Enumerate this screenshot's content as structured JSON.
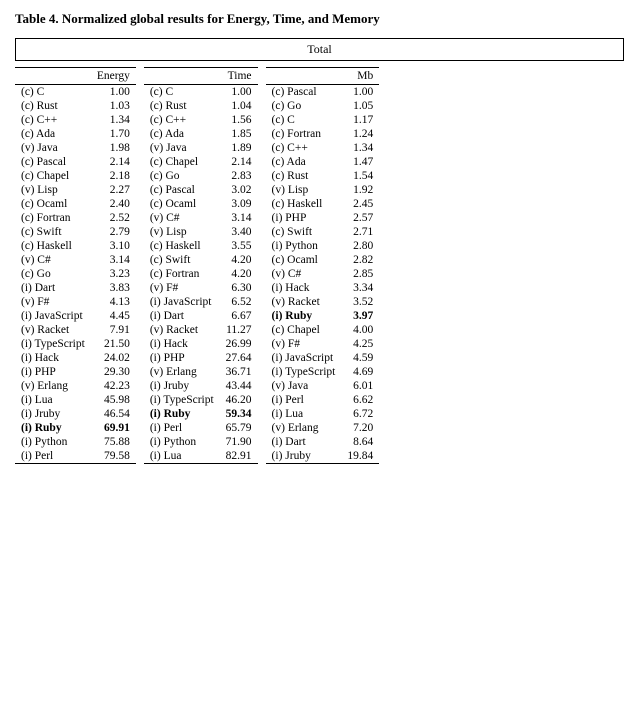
{
  "title": "Table 4. Normalized global results for Energy, Time, and Memory",
  "total_label": "Total",
  "energy_table": {
    "header": [
      "",
      "Energy"
    ],
    "rows": [
      [
        "(c) C",
        "1.00"
      ],
      [
        "(c) Rust",
        "1.03"
      ],
      [
        "(c) C++",
        "1.34"
      ],
      [
        "(c) Ada",
        "1.70"
      ],
      [
        "(v) Java",
        "1.98"
      ],
      [
        "(c) Pascal",
        "2.14"
      ],
      [
        "(c) Chapel",
        "2.18"
      ],
      [
        "(v) Lisp",
        "2.27"
      ],
      [
        "(c) Ocaml",
        "2.40"
      ],
      [
        "(c) Fortran",
        "2.52"
      ],
      [
        "(c) Swift",
        "2.79"
      ],
      [
        "(c) Haskell",
        "3.10"
      ],
      [
        "(v) C#",
        "3.14"
      ],
      [
        "(c) Go",
        "3.23"
      ],
      [
        "(i) Dart",
        "3.83"
      ],
      [
        "(v) F#",
        "4.13"
      ],
      [
        "(i) JavaScript",
        "4.45"
      ],
      [
        "(v) Racket",
        "7.91"
      ],
      [
        "(i) TypeScript",
        "21.50"
      ],
      [
        "(i) Hack",
        "24.02"
      ],
      [
        "(i) PHP",
        "29.30"
      ],
      [
        "(v) Erlang",
        "42.23"
      ],
      [
        "(i) Lua",
        "45.98"
      ],
      [
        "(i) Jruby",
        "46.54"
      ],
      [
        "(i) Ruby",
        "69.91"
      ],
      [
        "(i) Python",
        "75.88"
      ],
      [
        "(i) Perl",
        "79.58"
      ]
    ]
  },
  "time_table": {
    "header": [
      "",
      "Time"
    ],
    "rows": [
      [
        "(c) C",
        "1.00"
      ],
      [
        "(c) Rust",
        "1.04"
      ],
      [
        "(c) C++",
        "1.56"
      ],
      [
        "(c) Ada",
        "1.85"
      ],
      [
        "(v) Java",
        "1.89"
      ],
      [
        "(c) Chapel",
        "2.14"
      ],
      [
        "(c) Go",
        "2.83"
      ],
      [
        "(c) Pascal",
        "3.02"
      ],
      [
        "(c) Ocaml",
        "3.09"
      ],
      [
        "(v) C#",
        "3.14"
      ],
      [
        "(v) Lisp",
        "3.40"
      ],
      [
        "(c) Haskell",
        "3.55"
      ],
      [
        "(c) Swift",
        "4.20"
      ],
      [
        "(c) Fortran",
        "4.20"
      ],
      [
        "(v) F#",
        "6.30"
      ],
      [
        "(i) JavaScript",
        "6.52"
      ],
      [
        "(i) Dart",
        "6.67"
      ],
      [
        "(v) Racket",
        "11.27"
      ],
      [
        "(i) Hack",
        "26.99"
      ],
      [
        "(i) PHP",
        "27.64"
      ],
      [
        "(v) Erlang",
        "36.71"
      ],
      [
        "(i) Jruby",
        "43.44"
      ],
      [
        "(i) TypeScript",
        "46.20"
      ],
      [
        "(i) Ruby",
        "59.34"
      ],
      [
        "(i) Perl",
        "65.79"
      ],
      [
        "(i) Python",
        "71.90"
      ],
      [
        "(i) Lua",
        "82.91"
      ]
    ]
  },
  "memory_table": {
    "header": [
      "",
      "Mb"
    ],
    "rows": [
      [
        "(c) Pascal",
        "1.00"
      ],
      [
        "(c) Go",
        "1.05"
      ],
      [
        "(c) C",
        "1.17"
      ],
      [
        "(c) Fortran",
        "1.24"
      ],
      [
        "(c) C++",
        "1.34"
      ],
      [
        "(c) Ada",
        "1.47"
      ],
      [
        "(c) Rust",
        "1.54"
      ],
      [
        "(v) Lisp",
        "1.92"
      ],
      [
        "(c) Haskell",
        "2.45"
      ],
      [
        "(i) PHP",
        "2.57"
      ],
      [
        "(c) Swift",
        "2.71"
      ],
      [
        "(i) Python",
        "2.80"
      ],
      [
        "(c) Ocaml",
        "2.82"
      ],
      [
        "(v) C#",
        "2.85"
      ],
      [
        "(i) Hack",
        "3.34"
      ],
      [
        "(v) Racket",
        "3.52"
      ],
      [
        "(i) Ruby",
        "3.97"
      ],
      [
        "(c) Chapel",
        "4.00"
      ],
      [
        "(v) F#",
        "4.25"
      ],
      [
        "(i) JavaScript",
        "4.59"
      ],
      [
        "(i) TypeScript",
        "4.69"
      ],
      [
        "(v) Java",
        "6.01"
      ],
      [
        "(i) Perl",
        "6.62"
      ],
      [
        "(i) Lua",
        "6.72"
      ],
      [
        "(v) Erlang",
        "7.20"
      ],
      [
        "(i) Dart",
        "8.64"
      ],
      [
        "(i) Jruby",
        "19.84"
      ]
    ]
  }
}
